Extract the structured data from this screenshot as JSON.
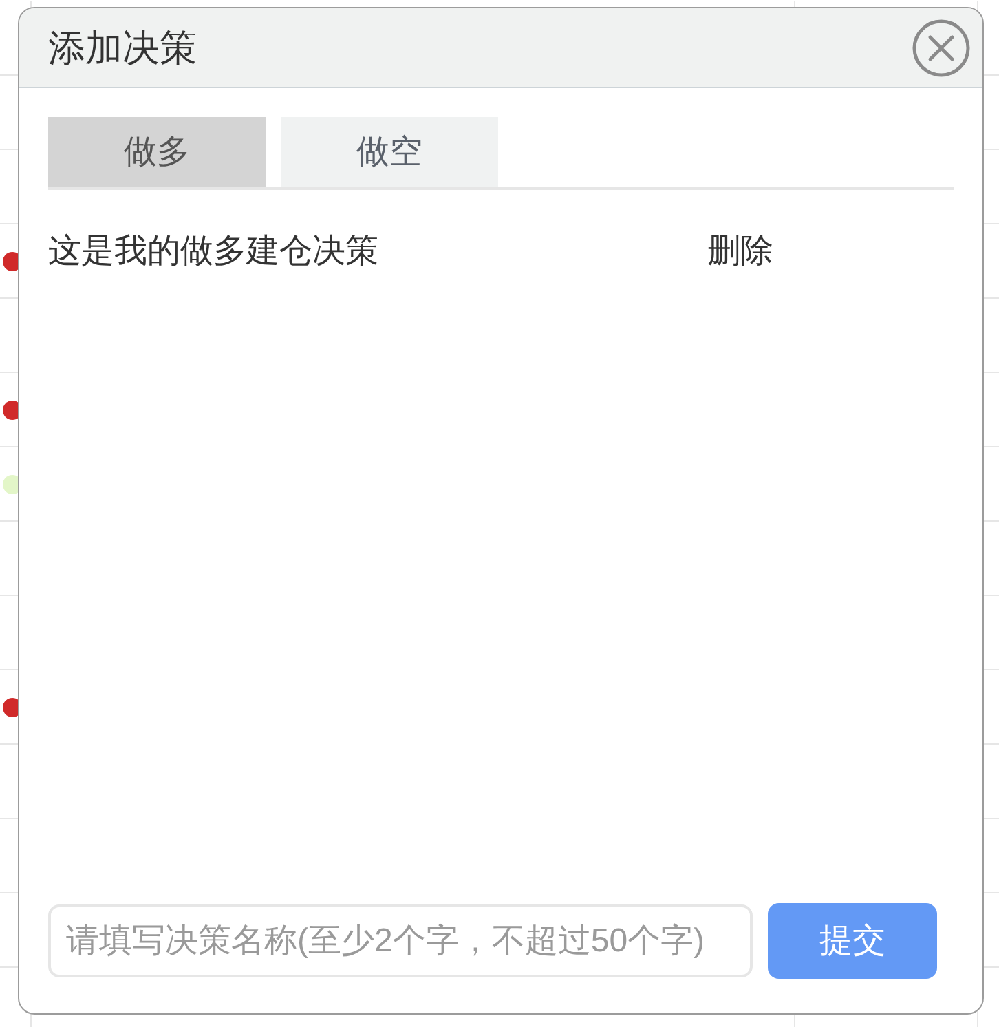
{
  "background": {
    "markers": [
      {
        "color": "#d02a2a"
      },
      {
        "color": "#d02a2a"
      },
      {
        "color": "#e3f6c8"
      },
      {
        "color": "#d02a2a"
      }
    ]
  },
  "dialog": {
    "title": "添加决策",
    "tabs": [
      {
        "label": "做多",
        "selected": true
      },
      {
        "label": "做空",
        "selected": false
      }
    ],
    "decisions": [
      {
        "name": "这是我的做多建仓决策",
        "action": "删除"
      }
    ],
    "name_field": {
      "placeholder": "请填写决策名称(至少2个字，不超过50个字)"
    },
    "submit": "提交"
  }
}
